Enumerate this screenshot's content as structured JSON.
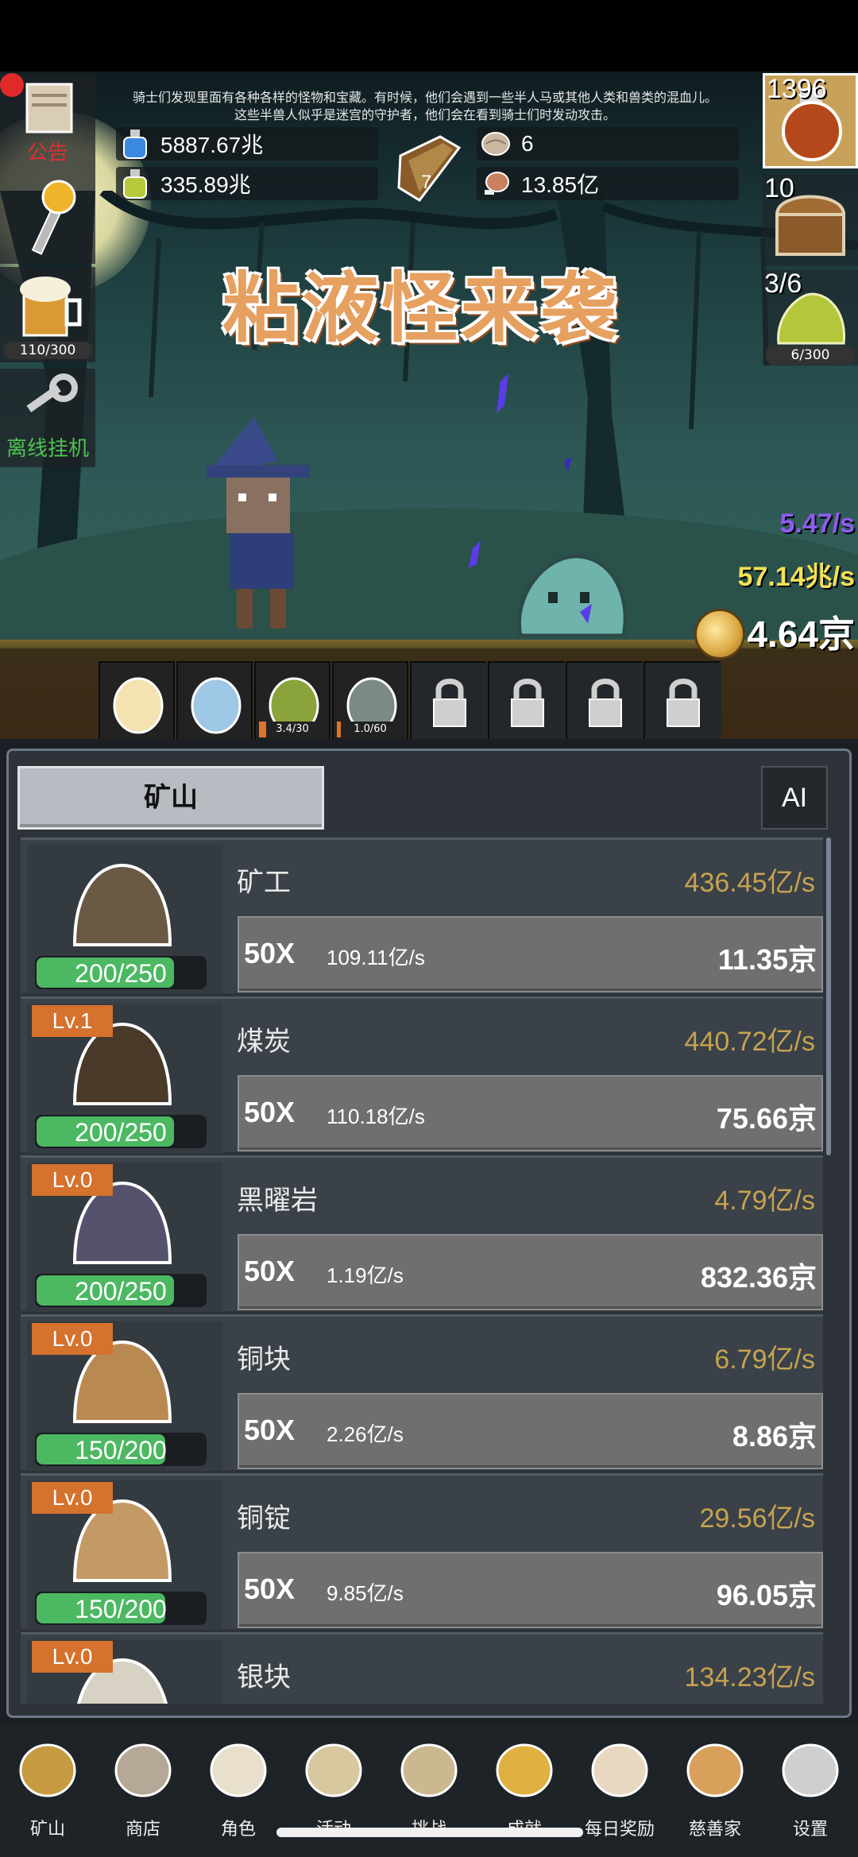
{
  "announcement": {
    "line1": "骑士们发现里面有各种各样的怪物和宝藏。有时候，他们会遇到一些半人马或其他人类和兽类的混血儿。",
    "line2": "这些半兽人似乎是迷宫的守护者，他们会在看到骑士们时发动攻击。"
  },
  "resources": {
    "blue_potion": "5887.67兆",
    "green_potion": "335.89兆",
    "book": "7",
    "shell": "6",
    "meat": "13.85亿"
  },
  "event_title": "粘液怪来袭",
  "left_side": {
    "notice_label": "公告",
    "beer_progress": "110/300",
    "offline_label": "离线挂机"
  },
  "right_side": {
    "potion_count": "1396",
    "chest_count": "10",
    "slime_count": "3/6",
    "slime_progress": "6/300"
  },
  "rates": {
    "purple": "5.47/s",
    "yellow": "57.14兆/s",
    "gold": "4.64京"
  },
  "char_bar": [
    {
      "name": "candle",
      "label": ""
    },
    {
      "name": "egg",
      "label": ""
    },
    {
      "name": "slime",
      "label": "3.4/30",
      "fill": 0.11
    },
    {
      "name": "zombie",
      "label": "1.0/60",
      "fill": 0.02
    },
    {
      "name": "locked-1",
      "label": ""
    },
    {
      "name": "locked-2",
      "label": ""
    },
    {
      "name": "locked-3",
      "label": ""
    },
    {
      "name": "locked-4",
      "label": ""
    }
  ],
  "panel": {
    "tab_mine": "矿山",
    "tab_ai": "AI"
  },
  "items": [
    {
      "key": "miner",
      "lv": "",
      "name": "矿工",
      "rate": "436.45亿/s",
      "count": "200/250",
      "fill": 0.8,
      "mult": "50X",
      "each": "109.11亿/s",
      "cost": "11.35京"
    },
    {
      "key": "coal",
      "lv": "Lv.1",
      "name": "煤炭",
      "rate": "440.72亿/s",
      "count": "200/250",
      "fill": 0.8,
      "mult": "50X",
      "each": "110.18亿/s",
      "cost": "75.66京"
    },
    {
      "key": "obsidian",
      "lv": "Lv.0",
      "name": "黑曜岩",
      "rate": "4.79亿/s",
      "count": "200/250",
      "fill": 0.8,
      "mult": "50X",
      "each": "1.19亿/s",
      "cost": "832.36京"
    },
    {
      "key": "copper-ore",
      "lv": "Lv.0",
      "name": "铜块",
      "rate": "6.79亿/s",
      "count": "150/200",
      "fill": 0.75,
      "mult": "50X",
      "each": "2.26亿/s",
      "cost": "8.86京"
    },
    {
      "key": "copper-ingot",
      "lv": "Lv.0",
      "name": "铜锭",
      "rate": "29.56亿/s",
      "count": "150/200",
      "fill": 0.75,
      "mult": "50X",
      "each": "9.85亿/s",
      "cost": "96.05京"
    },
    {
      "key": "silver-ore",
      "lv": "Lv.0",
      "name": "银块",
      "rate": "134.23亿/s",
      "count": "",
      "fill": 0,
      "mult": "",
      "each": "",
      "cost": ""
    }
  ],
  "nav": [
    {
      "key": "mine",
      "label": "矿山",
      "icon": "lantern-icon"
    },
    {
      "key": "shop",
      "label": "商店",
      "icon": "stone-tablet-icon"
    },
    {
      "key": "character",
      "label": "角色",
      "icon": "skull-icon"
    },
    {
      "key": "event",
      "label": "活动",
      "icon": "scroll-icon"
    },
    {
      "key": "challenge",
      "label": "挑战",
      "icon": "map-icon"
    },
    {
      "key": "achievement",
      "label": "成就",
      "icon": "key-icon"
    },
    {
      "key": "daily",
      "label": "每日奖励",
      "icon": "envelope-icon"
    },
    {
      "key": "donor",
      "label": "慈善家",
      "icon": "bread-icon"
    },
    {
      "key": "settings",
      "label": "设置",
      "icon": "gear-icon"
    }
  ]
}
